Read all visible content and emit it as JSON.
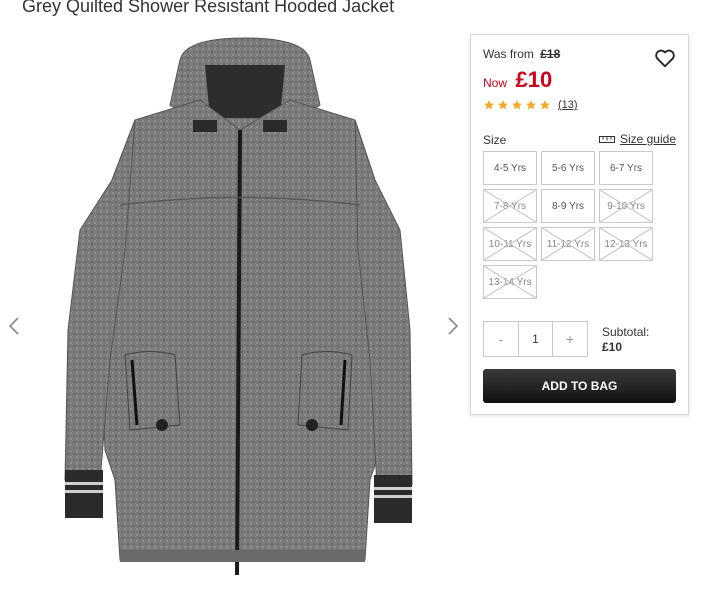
{
  "product": {
    "title": "Grey Quilted Shower Resistant Hooded Jacket"
  },
  "pricing": {
    "was_label": "Was from",
    "was_price": "£18",
    "now_label": "Now",
    "now_price": "£10"
  },
  "rating": {
    "stars": 5,
    "star_color": "#f5a623",
    "review_count": "(13)"
  },
  "sizes": {
    "label": "Size",
    "guide_label": "Size guide",
    "options": [
      {
        "label": "4-5 Yrs",
        "available": true
      },
      {
        "label": "5-6 Yrs",
        "available": true
      },
      {
        "label": "6-7 Yrs",
        "available": true
      },
      {
        "label": "7-8 Yrs",
        "available": false
      },
      {
        "label": "8-9 Yrs",
        "available": true
      },
      {
        "label": "9-10 Yrs",
        "available": false
      },
      {
        "label": "10-11 Yrs",
        "available": false
      },
      {
        "label": "11-12 Yrs",
        "available": false
      },
      {
        "label": "12-13 Yrs",
        "available": false
      },
      {
        "label": "13-14 Yrs",
        "available": false
      }
    ]
  },
  "quantity": {
    "decrement": "-",
    "value": "1",
    "increment": "+"
  },
  "subtotal": {
    "label": "Subtotal:",
    "value": "£10"
  },
  "actions": {
    "add_to_bag": "ADD TO BAG"
  },
  "colors": {
    "price_red": "#d0021b",
    "button_dark": "#1a1a1a"
  }
}
